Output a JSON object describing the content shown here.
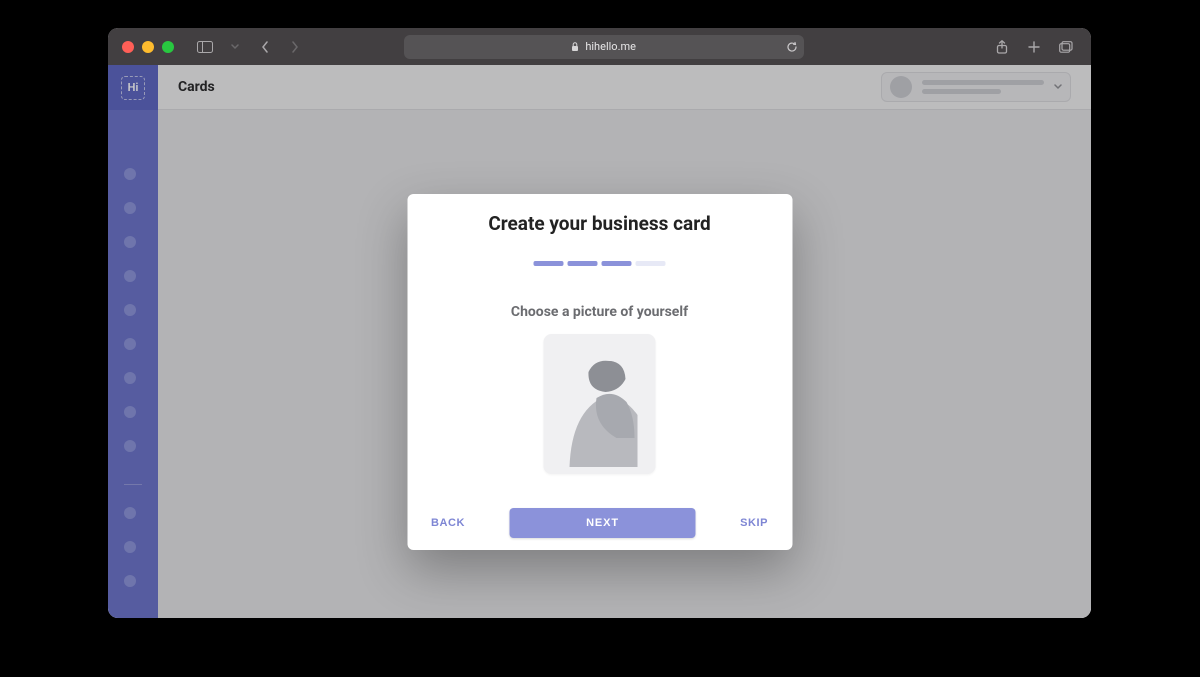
{
  "browser": {
    "url_host": "hihello.me"
  },
  "sidebar": {
    "logo_text": "Hi"
  },
  "topbar": {
    "title": "Cards"
  },
  "modal": {
    "title": "Create your business card",
    "subtitle": "Choose a picture of yourself",
    "progress": {
      "current": 3,
      "total": 4
    },
    "back_label": "BACK",
    "next_label": "NEXT",
    "skip_label": "SKIP"
  },
  "colors": {
    "accent": "#8b92da",
    "sidebar": "#6c74c8"
  }
}
